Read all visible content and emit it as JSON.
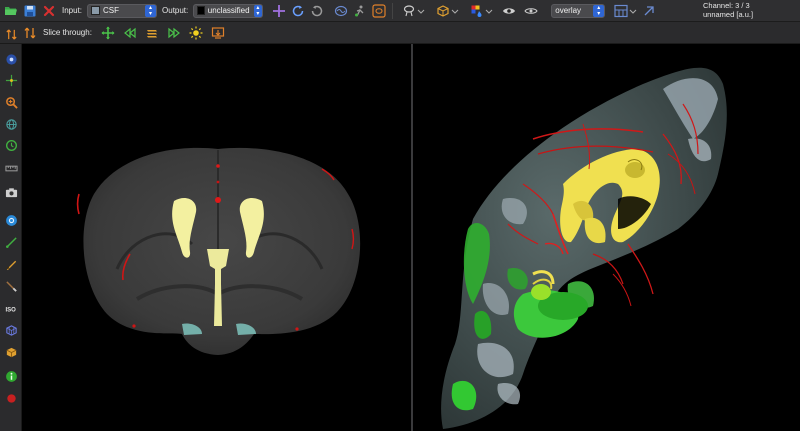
{
  "toolbar": {
    "input_label": "Input:",
    "input_value": "CSF",
    "input_color": "#8a9aa8",
    "output_label": "Output:",
    "output_value": "unclassified",
    "output_color": "#000000",
    "overlay_value": "overlay",
    "channel_line1": "Channel: 3 / 3",
    "channel_line2": "unnamed [a.u.]"
  },
  "slice_toolbar": {
    "slice_through_label": "Slice through:"
  },
  "icons": {
    "top": [
      "open-folder-icon",
      "save-icon",
      "close-red-x-icon",
      "crosshair-icon",
      "undo-icon",
      "redo-icon",
      "brain-3d-icon",
      "paint-figure-icon",
      "brain-orange-icon",
      "lasso-icon",
      "box-3d-icon",
      "color-drop-icon",
      "eye-mask-icon",
      "mask-mode-icon",
      "layout-icon",
      "lock-icon"
    ],
    "slice": [
      "move-cross-icon",
      "rewind-icon",
      "slice-stack-icon",
      "forward-icon",
      "brightness-icon",
      "export-icon"
    ],
    "left": [
      "swap-arrows-icon",
      "target-icon",
      "move-icon",
      "zoom-icon",
      "rotate-globe-icon",
      "clock-icon",
      "ruler-icon",
      "camera-icon",
      "info-circle-icon",
      "line-tool-icon",
      "pencil-icon",
      "scalpel-icon",
      "iso-icon",
      "mesh-icon",
      "cube-icon",
      "info-green-icon",
      "red-dot-icon"
    ]
  },
  "colors": {
    "accent_blue": "#2f66d4",
    "csf_yellow": "#f3f0a0",
    "vessel_red": "#e01818",
    "surface_green": "#32c832"
  }
}
